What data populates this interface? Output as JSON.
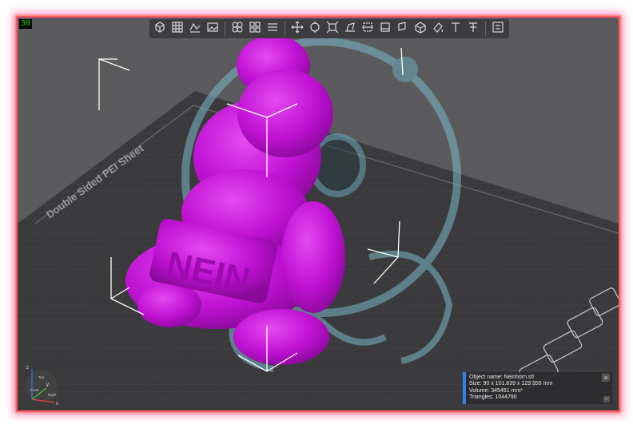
{
  "viewport": {
    "fps": "30",
    "bed_label": "Double Sided PEI Sheet"
  },
  "toolbar": {
    "groups": [
      [
        {
          "name": "add-object-icon",
          "label": "Add"
        },
        {
          "name": "grid-view-icon",
          "label": "Grid"
        },
        {
          "name": "arrange-icon",
          "label": "Arrange"
        },
        {
          "name": "image-icon",
          "label": "Image"
        }
      ],
      [
        {
          "name": "copies-icon",
          "label": "Copies"
        },
        {
          "name": "split-icon",
          "label": "Split"
        },
        {
          "name": "layers-icon",
          "label": "Layers"
        }
      ],
      [
        {
          "name": "move-icon",
          "label": "Move"
        },
        {
          "name": "rotate-icon",
          "label": "Rotate"
        },
        {
          "name": "scale-icon",
          "label": "Scale"
        },
        {
          "name": "place-on-face-icon",
          "label": "Place on face"
        },
        {
          "name": "cut-icon",
          "label": "Cut"
        },
        {
          "name": "support-paint-icon",
          "label": "Support"
        },
        {
          "name": "seam-paint-icon",
          "label": "Seam"
        },
        {
          "name": "mesh-boolean-icon",
          "label": "Boolean"
        },
        {
          "name": "color-paint-icon",
          "label": "Paint"
        },
        {
          "name": "text-icon",
          "label": "Text"
        },
        {
          "name": "measure-icon",
          "label": "Measure"
        }
      ],
      [
        {
          "name": "assembly-view-icon",
          "label": "Assembly"
        }
      ]
    ]
  },
  "info_panel": {
    "object_name": "Object name: Neinhorn.stl",
    "size": "Size: 90 x 101.839 x 129.555 mm",
    "volume": "Volume: 345451 mm³",
    "triangles": "Triangles: 1044790",
    "close_label": "×",
    "collapse_label": "–"
  },
  "axes": {
    "x_label": "x",
    "y_label": "y",
    "z_label": "z",
    "front_label": "Front",
    "right_label": "Right",
    "top_label": "Top"
  },
  "colors": {
    "bed": "#3a3a3c",
    "background": "#5b5b5e",
    "object_magenta": "#c814d8",
    "ghost_object": "#7ab8c8",
    "frame_border": "#ff5a6a",
    "panel_accent": "#2f82e8",
    "fps_text": "#1fe01f"
  }
}
